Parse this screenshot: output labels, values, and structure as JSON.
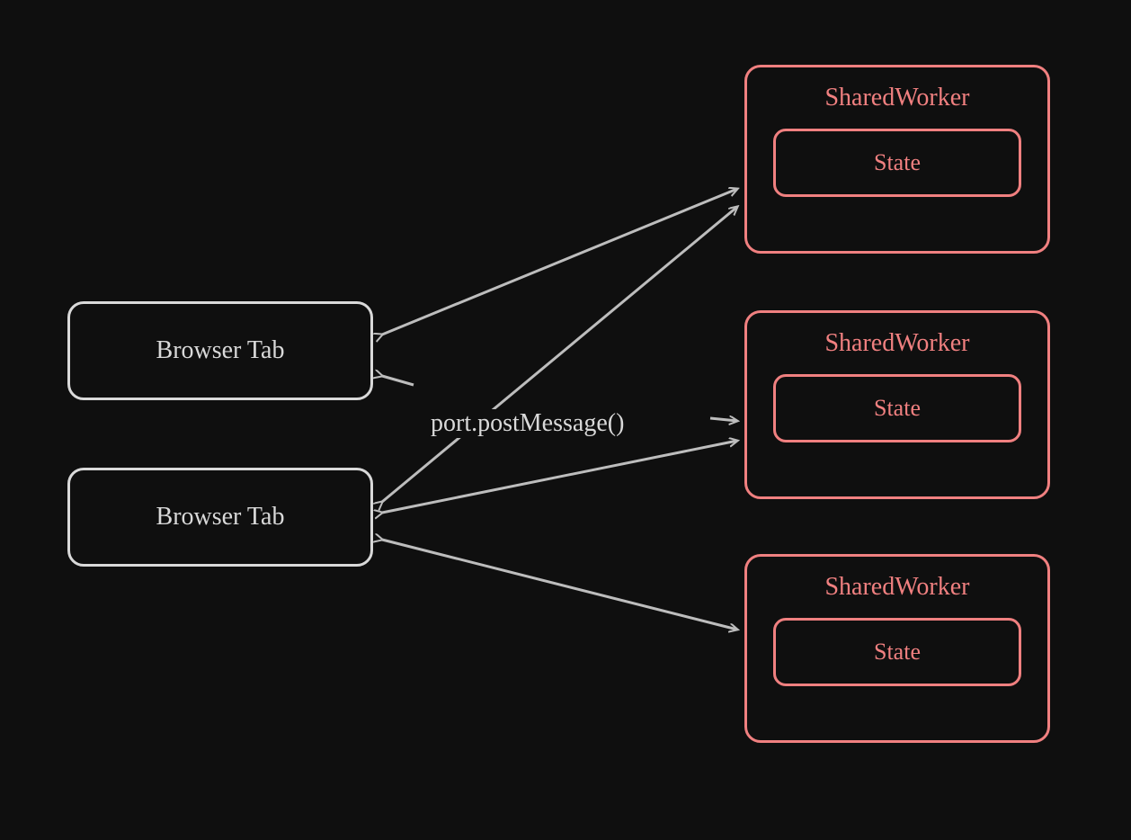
{
  "tabs": [
    {
      "label": "Browser Tab"
    },
    {
      "label": "Browser Tab"
    }
  ],
  "workers": [
    {
      "label": "SharedWorker",
      "state": "State"
    },
    {
      "label": "SharedWorker",
      "state": "State"
    },
    {
      "label": "SharedWorker",
      "state": "State"
    }
  ],
  "edge_label": "port.postMessage()",
  "colors": {
    "background": "#0f0f0f",
    "tab_border": "#d9d9d9",
    "worker_border": "#f08080",
    "arrow": "#bdbdbd"
  }
}
